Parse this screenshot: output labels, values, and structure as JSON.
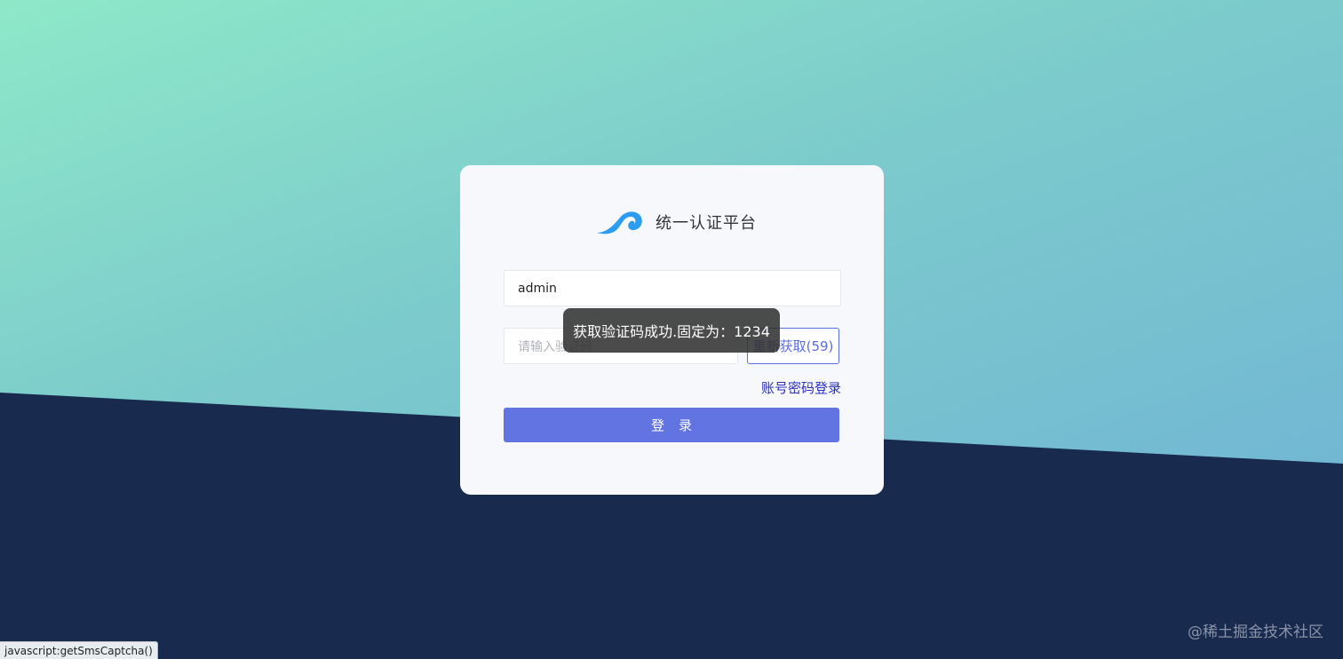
{
  "brand": {
    "title": "统一认证平台",
    "logo_icon": "wave-logo-icon"
  },
  "form": {
    "username_value": "admin",
    "code_placeholder": "请输入验证码",
    "resend_label": "重新获取(59)",
    "switch_label": "账号密码登录",
    "login_label": "登录"
  },
  "toast": {
    "message": "获取验证码成功.固定为：1234"
  },
  "watermark": "@稀土掘金技术社区",
  "statusbar": "javascript:getSmsCaptcha()",
  "colors": {
    "accent": "#6274e2",
    "link": "#2a2fb8",
    "background_dark": "#182a4d",
    "logo_blue": "#2b9cf0"
  }
}
